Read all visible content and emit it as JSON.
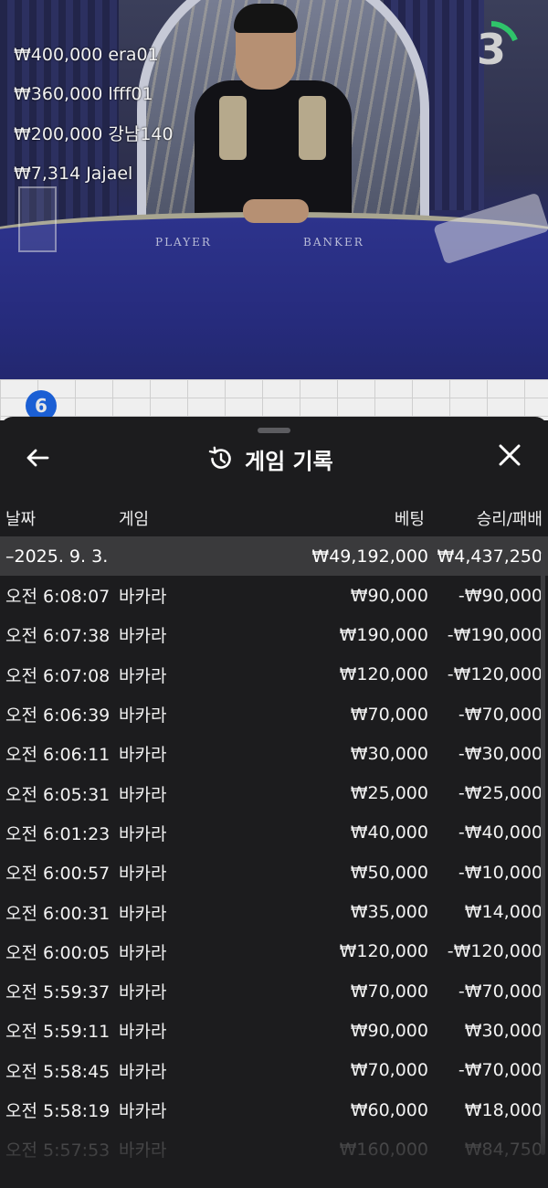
{
  "video": {
    "table_labels": {
      "player": "PLAYER",
      "banker": "BANKER"
    },
    "top_bets": [
      {
        "amount": "₩400,000",
        "user": "era01"
      },
      {
        "amount": "₩360,000",
        "user": "lfff01"
      },
      {
        "amount": "₩200,000",
        "user": "강남140"
      },
      {
        "amount": "₩7,314",
        "user": "Jajael"
      }
    ],
    "timer": "3",
    "road_badge": "6"
  },
  "panel": {
    "title": "게임 기록",
    "icons": {
      "back": "arrow-left-icon",
      "history": "history-icon",
      "close": "close-icon"
    },
    "columns": {
      "date": "날짜",
      "game": "게임",
      "bet": "베팅",
      "result": "승리/패배"
    },
    "summary": {
      "date": "–2025. 9. 3.",
      "bet": "₩49,192,000",
      "result": "₩4,437,250"
    },
    "rows": [
      {
        "time": "오전 6:08:07",
        "game": "바카라",
        "bet": "₩90,000",
        "result": "-₩90,000"
      },
      {
        "time": "오전 6:07:38",
        "game": "바카라",
        "bet": "₩190,000",
        "result": "-₩190,000"
      },
      {
        "time": "오전 6:07:08",
        "game": "바카라",
        "bet": "₩120,000",
        "result": "-₩120,000"
      },
      {
        "time": "오전 6:06:39",
        "game": "바카라",
        "bet": "₩70,000",
        "result": "-₩70,000"
      },
      {
        "time": "오전 6:06:11",
        "game": "바카라",
        "bet": "₩30,000",
        "result": "-₩30,000"
      },
      {
        "time": "오전 6:05:31",
        "game": "바카라",
        "bet": "₩25,000",
        "result": "-₩25,000"
      },
      {
        "time": "오전 6:01:23",
        "game": "바카라",
        "bet": "₩40,000",
        "result": "-₩40,000"
      },
      {
        "time": "오전 6:00:57",
        "game": "바카라",
        "bet": "₩50,000",
        "result": "-₩10,000"
      },
      {
        "time": "오전 6:00:31",
        "game": "바카라",
        "bet": "₩35,000",
        "result": "₩14,000"
      },
      {
        "time": "오전 6:00:05",
        "game": "바카라",
        "bet": "₩120,000",
        "result": "-₩120,000"
      },
      {
        "time": "오전 5:59:37",
        "game": "바카라",
        "bet": "₩70,000",
        "result": "-₩70,000"
      },
      {
        "time": "오전 5:59:11",
        "game": "바카라",
        "bet": "₩90,000",
        "result": "₩30,000"
      },
      {
        "time": "오전 5:58:45",
        "game": "바카라",
        "bet": "₩70,000",
        "result": "-₩70,000"
      },
      {
        "time": "오전 5:58:19",
        "game": "바카라",
        "bet": "₩60,000",
        "result": "₩18,000"
      },
      {
        "time": "오전 5:57:53",
        "game": "바카라",
        "bet": "₩160,000",
        "result": "₩84,750"
      }
    ]
  }
}
